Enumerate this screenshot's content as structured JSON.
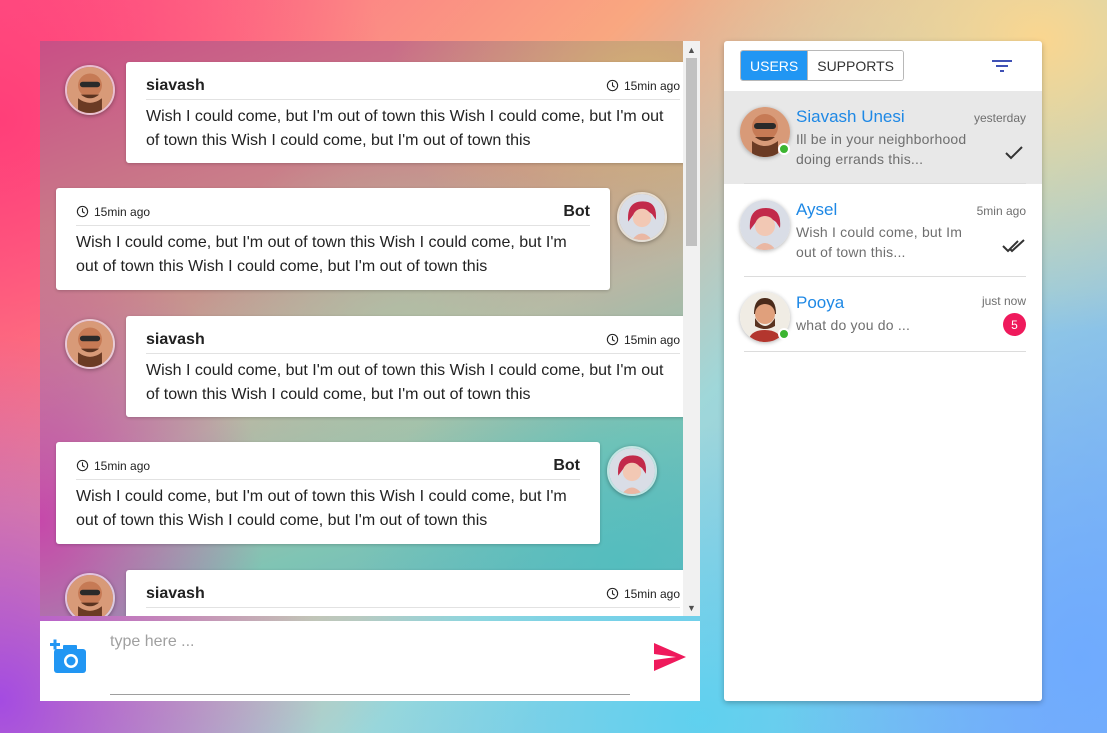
{
  "chat": {
    "messages": [
      {
        "sender": "siavash",
        "time": "15min ago",
        "text": "Wish I could come, but I'm out of town this Wish I could come, but I'm out of town this Wish I could come, but I'm out of town this"
      },
      {
        "sender": "Bot",
        "time": "15min ago",
        "text": "Wish I could come, but I'm out of town this Wish I could come, but I'm out of town this Wish I could come, but I'm out of town this"
      },
      {
        "sender": "siavash",
        "time": "15min ago",
        "text": "Wish I could come, but I'm out of town this Wish I could come, but I'm out of town this Wish I could come, but I'm out of town this"
      },
      {
        "sender": "Bot",
        "time": "15min ago",
        "text": "Wish I could come, but I'm out of town this Wish I could come, but I'm out of town this Wish I could come, but I'm out of town this"
      },
      {
        "sender": "siavash",
        "time": "15min ago",
        "text": ""
      }
    ]
  },
  "composer": {
    "placeholder": "type here ...",
    "camera_icon": "add-photo-icon",
    "send_icon": "send-icon",
    "send_color": "#ef1a5c",
    "camera_color": "#2196f3"
  },
  "contacts": {
    "tabs": [
      {
        "label": "USERS",
        "active": true
      },
      {
        "label": "SUPPORTS",
        "active": false
      }
    ],
    "filter_icon": "filter-icon",
    "accent": "#2196f3",
    "items": [
      {
        "name": "Siavash Unesi",
        "preview": "Ill be in your neighborhood doing errands this...",
        "time": "yesterday",
        "status": "single-check",
        "online": true,
        "selected": true
      },
      {
        "name": "Aysel",
        "preview": "Wish I could come, but Im out of town this...",
        "time": "5min ago",
        "status": "double-check",
        "online": false,
        "selected": false
      },
      {
        "name": "Pooya",
        "preview": "what do you do ...",
        "time": "just now",
        "unread": "5",
        "online": true,
        "selected": false
      }
    ]
  }
}
